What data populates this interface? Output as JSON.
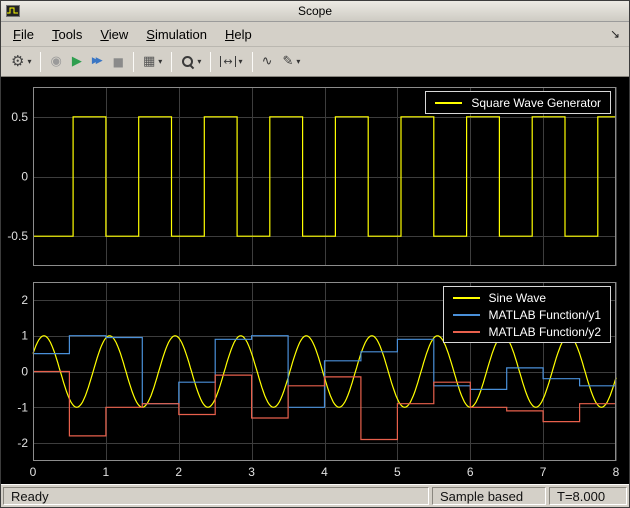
{
  "window": {
    "title": "Scope",
    "app_icon": "scope-icon"
  },
  "menu": {
    "items": [
      {
        "label": "File"
      },
      {
        "label": "Tools"
      },
      {
        "label": "View"
      },
      {
        "label": "Simulation"
      },
      {
        "label": "Help"
      }
    ],
    "dock_glyph": "↘"
  },
  "toolbar": {
    "dropdown_glyph": "▾",
    "buttons": [
      {
        "name": "settings",
        "icon": "gear-icon",
        "glyph": "⚙",
        "dropdown": true
      },
      {
        "name": "step-back",
        "icon": "step-back-icon",
        "glyph": "◉",
        "dropdown": false
      },
      {
        "name": "run",
        "icon": "run-icon",
        "glyph": "▶",
        "dropdown": false
      },
      {
        "name": "step-forward",
        "icon": "step-forward-icon",
        "glyph": "▶▶",
        "dropdown": false
      },
      {
        "name": "stop",
        "icon": "stop-icon",
        "glyph": "■",
        "dropdown": false
      },
      {
        "name": "stepping-options",
        "icon": "stepping-options-icon",
        "glyph": "▦",
        "dropdown": true
      },
      {
        "name": "zoom",
        "icon": "magnifier-icon",
        "glyph": "",
        "dropdown": true
      },
      {
        "name": "autoscale",
        "icon": "autoscale-span-icon",
        "glyph": "↔",
        "dropdown": true
      },
      {
        "name": "triggers",
        "icon": "trigger-waveform-icon",
        "glyph": "∿",
        "dropdown": false
      },
      {
        "name": "measurements",
        "icon": "measurements-pen-icon",
        "glyph": "✎",
        "dropdown": true
      }
    ]
  },
  "status_bar": {
    "status": "Ready",
    "sample_mode": "Sample based",
    "time": "T=8.000"
  },
  "colors": {
    "trace_yellow": "#ffff00",
    "trace_blue": "#4a90d9",
    "trace_red": "#e8604c",
    "plot_background": "#000000",
    "grid": "#3d3d3d",
    "axes_box": "#8c8c8c",
    "tick_text": "#e0e0e0",
    "chrome_gray": "#d4d0c8"
  },
  "chart_data": [
    {
      "type": "line",
      "title": "",
      "xlabel": "",
      "ylabel": "",
      "xlim": [
        0,
        8
      ],
      "ylim": [
        -0.75,
        0.75
      ],
      "xticks": [
        0,
        1,
        2,
        3,
        4,
        5,
        6,
        7,
        8
      ],
      "yticks": [
        -0.5,
        0,
        0.5
      ],
      "show_x_tick_labels": false,
      "grid": true,
      "legend_position": "top-right",
      "background": "#000000",
      "series": [
        {
          "name": "Square Wave Generator",
          "color": "#ffff00",
          "kind": "square",
          "amplitude": 0.5,
          "half_period": 0.45,
          "first_rise": 0.55,
          "start_level": -0.5
        }
      ]
    },
    {
      "type": "line",
      "title": "",
      "xlabel": "",
      "ylabel": "",
      "xlim": [
        0,
        8
      ],
      "ylim": [
        -2.5,
        2.5
      ],
      "xticks": [
        0,
        1,
        2,
        3,
        4,
        5,
        6,
        7,
        8
      ],
      "yticks": [
        -2,
        -1,
        0,
        1,
        2
      ],
      "show_x_tick_labels": true,
      "grid": true,
      "legend_position": "top-right",
      "background": "#000000",
      "series": [
        {
          "name": "Sine Wave",
          "color": "#ffff00",
          "kind": "sine",
          "amplitude": 1,
          "period": 0.9,
          "peak_time": 0.15
        },
        {
          "name": "MATLAB Function/y1",
          "color": "#4a90d9",
          "kind": "stair",
          "steps": [
            [
              0,
              0.5
            ],
            [
              0.5,
              1.0
            ],
            [
              1.0,
              0.95
            ],
            [
              1.5,
              -0.9
            ],
            [
              2.0,
              -0.3
            ],
            [
              2.5,
              0.9
            ],
            [
              3.0,
              1.0
            ],
            [
              3.5,
              -1.0
            ],
            [
              4.0,
              0.3
            ],
            [
              4.5,
              0.55
            ],
            [
              5.0,
              0.9
            ],
            [
              5.5,
              -0.4
            ],
            [
              6.0,
              -0.5
            ],
            [
              6.5,
              0.1
            ],
            [
              7.0,
              -0.2
            ],
            [
              7.5,
              -0.4
            ]
          ]
        },
        {
          "name": "MATLAB Function/y2",
          "color": "#e8604c",
          "kind": "stair",
          "steps": [
            [
              0,
              0
            ],
            [
              0.5,
              -1.8
            ],
            [
              1.0,
              -1.0
            ],
            [
              1.5,
              -0.9
            ],
            [
              2.0,
              -1.2
            ],
            [
              2.5,
              -0.1
            ],
            [
              3.0,
              -1.3
            ],
            [
              3.5,
              -0.4
            ],
            [
              4.0,
              -0.15
            ],
            [
              4.5,
              -1.9
            ],
            [
              5.0,
              -0.9
            ],
            [
              5.5,
              -0.3
            ],
            [
              6.0,
              -1.0
            ],
            [
              6.5,
              -1.1
            ],
            [
              7.0,
              -1.4
            ],
            [
              7.5,
              -0.9
            ]
          ]
        }
      ]
    }
  ]
}
